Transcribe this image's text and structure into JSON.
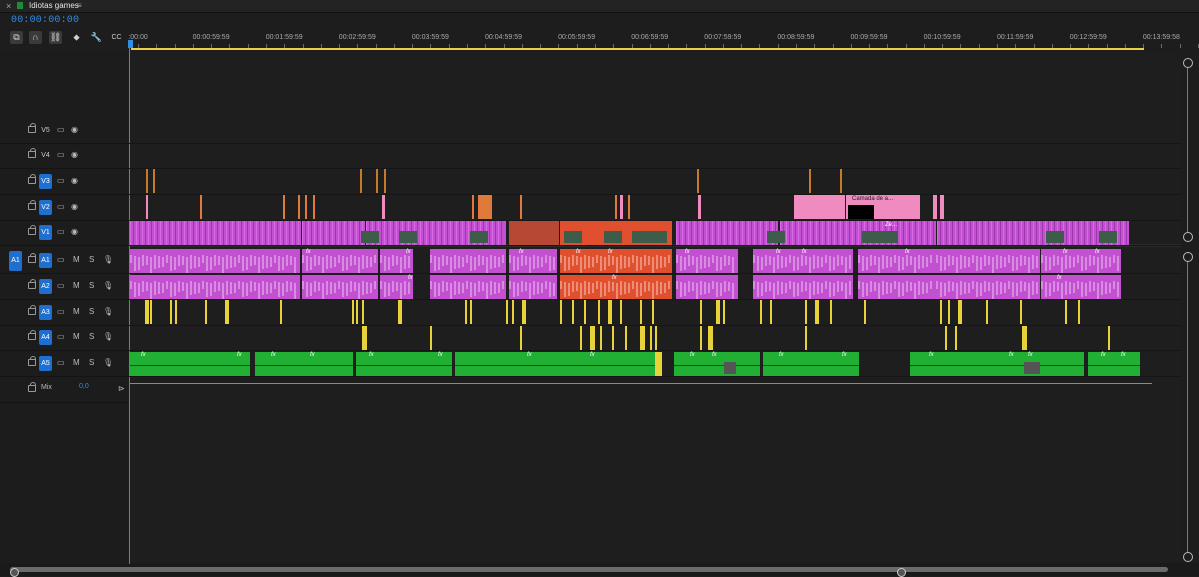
{
  "tab": {
    "close": "×",
    "title": "Idiotas games",
    "menu": "≡"
  },
  "timecode": "00:00:00:00",
  "toolbar": {
    "tools": [
      "nest-icon",
      "snap-magnet-icon",
      "linked-selection-icon",
      "add-marker-icon",
      "wrench-icon",
      "captions-icon"
    ],
    "captions_label": "CC"
  },
  "ruler": {
    "labels": [
      ":00:00",
      "00:00:59:59",
      "00:01:59:59",
      "00:02:59:59",
      "00:03:59:59",
      "00:04:59:59",
      "00:05:59:59",
      "00:06:59:59",
      "00:07:59:59",
      "00:08:59:59",
      "00:09:59:59",
      "00:10:59:59",
      "00:11:59:59",
      "00:12:59:59",
      "00:13:59:58"
    ]
  },
  "video_tracks": [
    {
      "name": "V5",
      "targeted": false
    },
    {
      "name": "V4",
      "targeted": false
    },
    {
      "name": "V3",
      "targeted": true
    },
    {
      "name": "V2",
      "targeted": true
    },
    {
      "name": "V1",
      "targeted": true
    }
  ],
  "audio_tracks": [
    {
      "name": "A1",
      "source": "A1",
      "mute": "M",
      "solo": "S"
    },
    {
      "name": "A2",
      "source": "",
      "mute": "M",
      "solo": "S"
    },
    {
      "name": "A3",
      "source": "",
      "mute": "M",
      "solo": "S"
    },
    {
      "name": "A4",
      "source": "",
      "mute": "M",
      "solo": "S"
    },
    {
      "name": "A5",
      "source": "",
      "mute": "M",
      "solo": "S"
    }
  ],
  "mix": {
    "label": "Mix",
    "value": "0,0"
  },
  "clip_labels": {
    "v2_text": "Camada de a...",
    "v1_text": "Ze...",
    "fx": "fx"
  },
  "colors": {
    "accent": "#2e8ee8",
    "video_clip": "#c34fd1",
    "video_clip_dark": "#7a2a8a",
    "orange": "#e07a3a",
    "red": "#e0502f",
    "pink": "#f08bc0",
    "yellow": "#e8d23a",
    "green": "#21b034",
    "workarea": "#e9d24a"
  }
}
